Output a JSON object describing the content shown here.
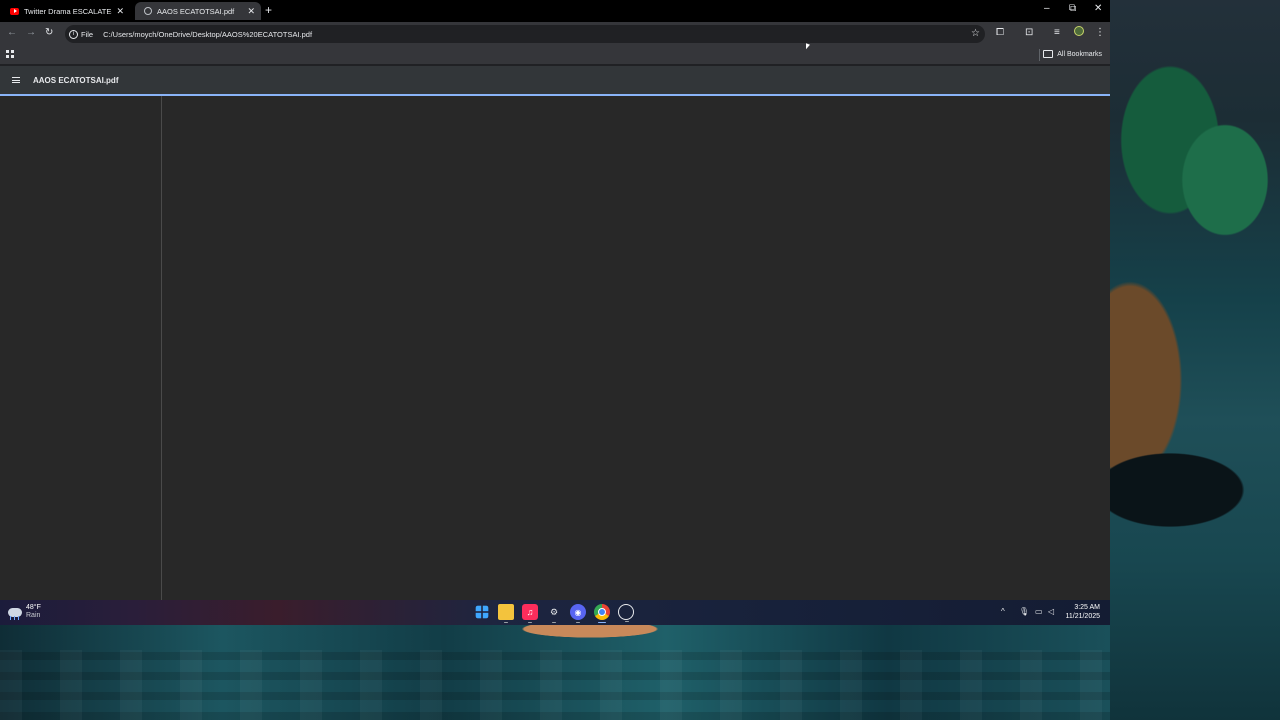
{
  "tabs": [
    {
      "title": "Twitter Drama ESCALATES Into",
      "favicon": "youtube-icon",
      "active": false
    },
    {
      "title": "AAOS ECATOTSAI.pdf",
      "favicon": "globe-icon",
      "active": true
    }
  ],
  "toolbar": {
    "scheme_label": "File",
    "url": "C:/Users/moych/OneDrive/Desktop/AAOS%20ECATOTSAI.pdf"
  },
  "bookmarks": {
    "all_bookmarks_label": "All Bookmarks"
  },
  "pdf": {
    "title": "AAOS ECATOTSAI.pdf"
  },
  "taskbar": {
    "weather": {
      "temp": "48°F",
      "condition": "Rain"
    },
    "pinned_apps": [
      "windows-start",
      "file-explorer",
      "itunes",
      "steam",
      "discord",
      "chrome",
      "other-app"
    ],
    "clock": {
      "time": "3:25 AM",
      "date": "11/21/2025"
    }
  },
  "colors": {
    "accent": "#8ab4f8",
    "tabstrip": "#000000",
    "toolbar": "#35363a",
    "viewer": "#282828"
  }
}
